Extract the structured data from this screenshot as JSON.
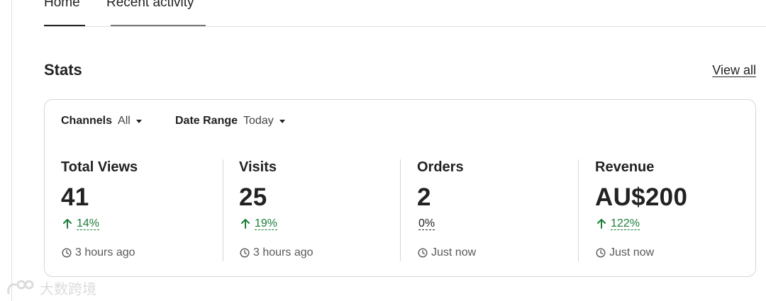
{
  "tabs": [
    {
      "label": "Home"
    },
    {
      "label": "Recent activity"
    }
  ],
  "stats": {
    "title": "Stats",
    "view_all": "View all"
  },
  "filters": {
    "channels": {
      "label": "Channels",
      "value": "All"
    },
    "date_range": {
      "label": "Date Range",
      "value": "Today"
    }
  },
  "metrics": [
    {
      "label": "Total Views",
      "value": "41",
      "change": "14%",
      "trend": "up",
      "updated": "3 hours ago"
    },
    {
      "label": "Visits",
      "value": "25",
      "change": "19%",
      "trend": "up",
      "updated": "3 hours ago"
    },
    {
      "label": "Orders",
      "value": "2",
      "change": "0%",
      "trend": "flat",
      "updated": "Just now"
    },
    {
      "label": "Revenue",
      "value": "AU$200",
      "change": "122%",
      "trend": "up",
      "updated": "Just now"
    }
  ],
  "colors": {
    "positive": "#1b7e3a",
    "text": "#222222",
    "muted": "#595959",
    "border": "#d6d6d6"
  },
  "watermark": {
    "text": "大数跨境"
  }
}
